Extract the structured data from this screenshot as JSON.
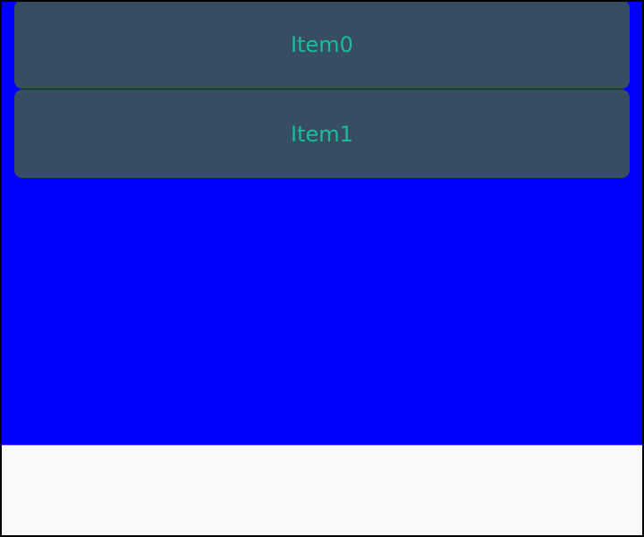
{
  "list": {
    "items": [
      {
        "label": "Item0"
      },
      {
        "label": "Item1"
      }
    ]
  },
  "colors": {
    "list_background": "#0000ff",
    "item_background": "#374d61",
    "item_text": "#1abc9c",
    "bottom_panel": "#f9f9f9",
    "frame_border": "#000000"
  }
}
